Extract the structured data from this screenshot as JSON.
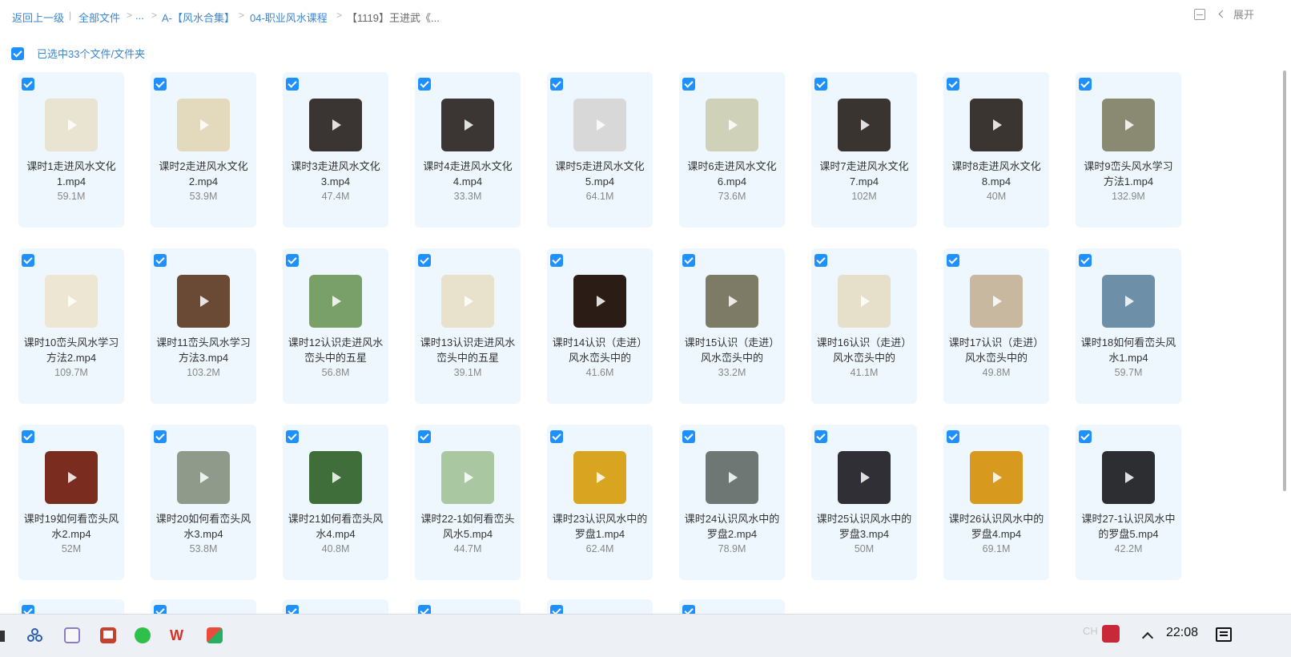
{
  "breadcrumb": {
    "back": "返回上一级",
    "all_files": "全部文件",
    "ellipsis": "...",
    "folder1": "A-【风水合集】",
    "folder2": "04-职业风水课程",
    "current": "【1119】王进武《..."
  },
  "toolbar": {
    "expand_label": "展开"
  },
  "selection": {
    "text": "已选中33个文件/文件夹"
  },
  "files": [
    {
      "name": "课时1走进风水文化1.mp4",
      "size": "59.1M",
      "thumb": "#e9e3d1"
    },
    {
      "name": "课时2走进风水文化2.mp4",
      "size": "53.9M",
      "thumb": "#e3d9bd"
    },
    {
      "name": "课时3走进风水文化3.mp4",
      "size": "47.4M",
      "thumb": "#3a3532"
    },
    {
      "name": "课时4走进风水文化4.mp4",
      "size": "33.3M",
      "thumb": "#3b3633"
    },
    {
      "name": "课时5走进风水文化5.mp4",
      "size": "64.1M",
      "thumb": "#d8d8d8"
    },
    {
      "name": "课时6走进风水文化6.mp4",
      "size": "73.6M",
      "thumb": "#cfd2b8"
    },
    {
      "name": "课时7走进风水文化7.mp4",
      "size": "102M",
      "thumb": "#3a3431"
    },
    {
      "name": "课时8走进风水文化8.mp4",
      "size": "40M",
      "thumb": "#3b3532"
    },
    {
      "name": "课时9峦头风水学习方法1.mp4",
      "size": "132.9M",
      "thumb": "#8a8a72"
    },
    {
      "name": "课时10峦头风水学习方法2.mp4",
      "size": "109.7M",
      "thumb": "#ede6d2"
    },
    {
      "name": "课时11峦头风水学习方法3.mp4",
      "size": "103.2M",
      "thumb": "#6b4a35"
    },
    {
      "name": "课时12认识走进风水峦头中的五星",
      "size": "56.8M",
      "thumb": "#7aa06a"
    },
    {
      "name": "课时13认识走进风水峦头中的五星",
      "size": "39.1M",
      "thumb": "#e8e1cc"
    },
    {
      "name": "课时14认识（走进）风水峦头中的",
      "size": "41.6M",
      "thumb": "#2b1d15"
    },
    {
      "name": "课时15认识（走进）风水峦头中的",
      "size": "33.2M",
      "thumb": "#7d7a66"
    },
    {
      "name": "课时16认识（走进）风水峦头中的",
      "size": "41.1M",
      "thumb": "#e6dfc9"
    },
    {
      "name": "课时17认识（走进）风水峦头中的",
      "size": "49.8M",
      "thumb": "#c9b8a0"
    },
    {
      "name": "课时18如何看峦头风水1.mp4",
      "size": "59.7M",
      "thumb": "#6e8fa8"
    },
    {
      "name": "课时19如何看峦头风水2.mp4",
      "size": "52M",
      "thumb": "#7a2c1e"
    },
    {
      "name": "课时20如何看峦头风水3.mp4",
      "size": "53.8M",
      "thumb": "#8f9a8a"
    },
    {
      "name": "课时21如何看峦头风水4.mp4",
      "size": "40.8M",
      "thumb": "#3f6e3a"
    },
    {
      "name": "课时22-1如何看峦头风水5.mp4",
      "size": "44.7M",
      "thumb": "#a9c7a0"
    },
    {
      "name": "课时23认识风水中的罗盘1.mp4",
      "size": "62.4M",
      "thumb": "#d9a520"
    },
    {
      "name": "课时24认识风水中的罗盘2.mp4",
      "size": "78.9M",
      "thumb": "#6f7775"
    },
    {
      "name": "课时25认识风水中的罗盘3.mp4",
      "size": "50M",
      "thumb": "#2f2f35"
    },
    {
      "name": "课时26认识风水中的罗盘4.mp4",
      "size": "69.1M",
      "thumb": "#d89a1e"
    },
    {
      "name": "课时27-1认识风水中的罗盘5.mp4",
      "size": "42.2M",
      "thumb": "#2c2e32"
    }
  ],
  "taskbar": {
    "input_method": "CH",
    "clock": "22:08"
  }
}
